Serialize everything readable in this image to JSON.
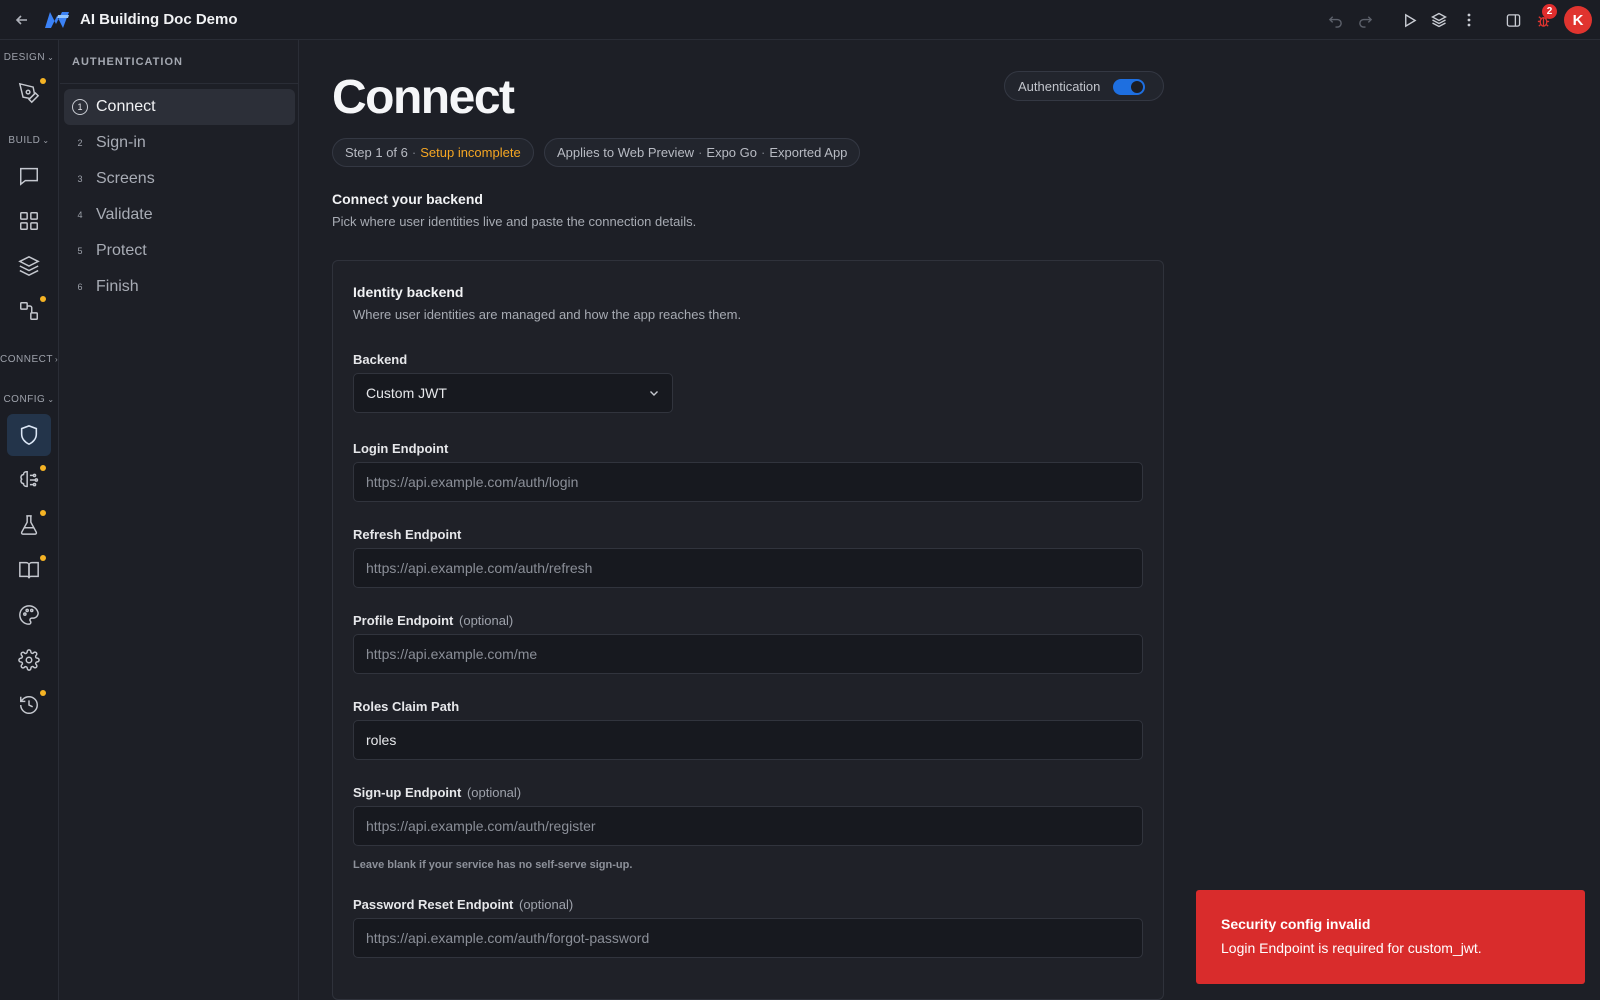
{
  "app": {
    "title": "AI Building Doc Demo"
  },
  "topbar": {
    "icons": [
      "back-arrow-icon",
      "logo-icon",
      "undo-icon",
      "redo-icon",
      "play-icon",
      "layers-icon",
      "more-vertical-icon",
      "panel-toggle-icon",
      "bug-icon"
    ],
    "bug_count": "2",
    "avatar_initial": "K"
  },
  "rail": {
    "sections": {
      "design": "DESIGN",
      "build": "BUILD",
      "connect": "CONNECT",
      "config": "CONFIG"
    },
    "icons": [
      "pen-icon",
      "chat-icon",
      "grid-icon",
      "layers-icon",
      "flow-icon",
      "shield-icon",
      "brain-icon",
      "flask-icon",
      "book-icon",
      "palette-icon",
      "gear-icon",
      "history-icon"
    ],
    "notify_color": "#f5b324"
  },
  "steps": {
    "heading": "AUTHENTICATION",
    "items": [
      {
        "num": "1",
        "label": "Connect"
      },
      {
        "num": "2",
        "label": "Sign-in"
      },
      {
        "num": "3",
        "label": "Screens"
      },
      {
        "num": "4",
        "label": "Validate"
      },
      {
        "num": "5",
        "label": "Protect"
      },
      {
        "num": "6",
        "label": "Finish"
      }
    ]
  },
  "main": {
    "title": "Connect",
    "auth_toggle": {
      "label": "Authentication",
      "on": true,
      "color": "#1e6fe0"
    },
    "status_pill": {
      "step": "Step 1 of 6",
      "sep": "·",
      "state": "Setup incomplete",
      "state_color": "#f5a623"
    },
    "applies_pill": {
      "prefix": "Applies to",
      "targets": [
        "Web Preview",
        "Expo Go",
        "Exported App"
      ],
      "sep": "·"
    },
    "section": {
      "title": "Connect your backend",
      "desc": "Pick where user identities live and paste the connection details."
    },
    "card": {
      "title": "Identity backend",
      "desc": "Where user identities are managed and how the app reaches them.",
      "backend": {
        "label": "Backend",
        "value": "Custom JWT"
      },
      "fields": {
        "login": {
          "label": "Login Endpoint",
          "placeholder": "https://api.example.com/auth/login",
          "value": ""
        },
        "refresh": {
          "label": "Refresh Endpoint",
          "placeholder": "https://api.example.com/auth/refresh",
          "value": ""
        },
        "profile": {
          "label": "Profile Endpoint",
          "optional": "(optional)",
          "placeholder": "https://api.example.com/me",
          "value": ""
        },
        "roles": {
          "label": "Roles Claim Path",
          "placeholder": "",
          "value": "roles"
        },
        "signup": {
          "label": "Sign-up Endpoint",
          "optional": "(optional)",
          "placeholder": "https://api.example.com/auth/register",
          "value": "",
          "hint": "Leave blank if your service has no self-serve sign-up."
        },
        "reset": {
          "label": "Password Reset Endpoint",
          "optional": "(optional)",
          "placeholder": "https://api.example.com/auth/forgot-password",
          "value": ""
        }
      }
    }
  },
  "toast": {
    "title": "Security config invalid",
    "message": "Login Endpoint is required for custom_jwt.",
    "color": "#d92c2c"
  }
}
